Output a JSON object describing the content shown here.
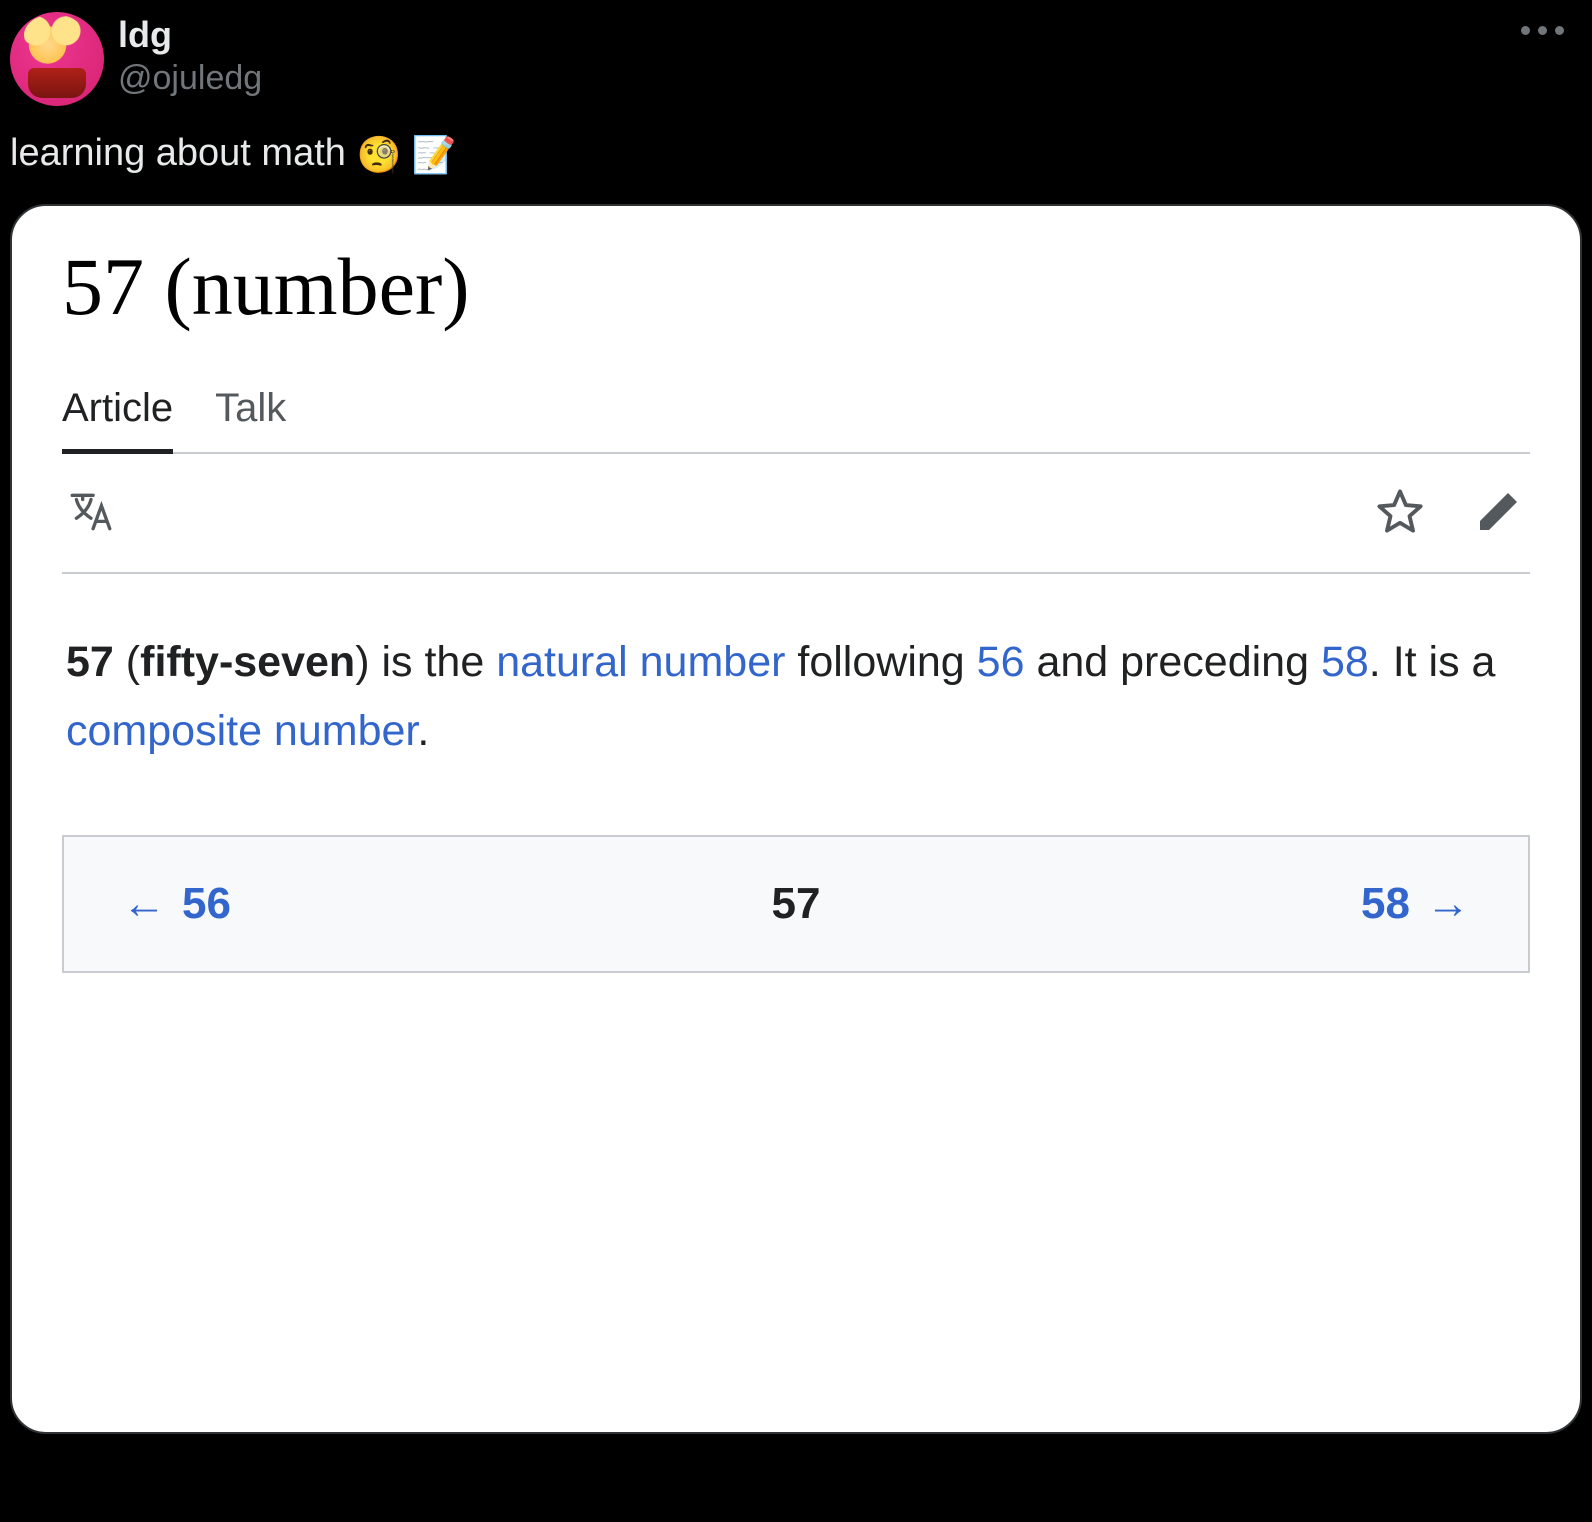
{
  "tweet": {
    "user": {
      "display_name": "ldg",
      "handle": "@ojuledg"
    },
    "text_prefix": "learning about math ",
    "emoji1": "🧐",
    "emoji2": "📝"
  },
  "article": {
    "title": "57 (number)",
    "tabs": {
      "article": "Article",
      "talk": "Talk"
    },
    "lead": {
      "bold1": "57",
      "paren_open": " (",
      "bold2": "fifty-seven",
      "paren_close": ")",
      "t1": " is the ",
      "link1": "natural number",
      "t2": " following ",
      "link2": "56",
      "t3": " and preceding ",
      "link3": "58",
      "t4": ". It is a ",
      "link4": "composite number",
      "t5": "."
    },
    "nav": {
      "prev_arrow": "←",
      "prev": "56",
      "current": "57",
      "next": "58",
      "next_arrow": "→"
    }
  }
}
